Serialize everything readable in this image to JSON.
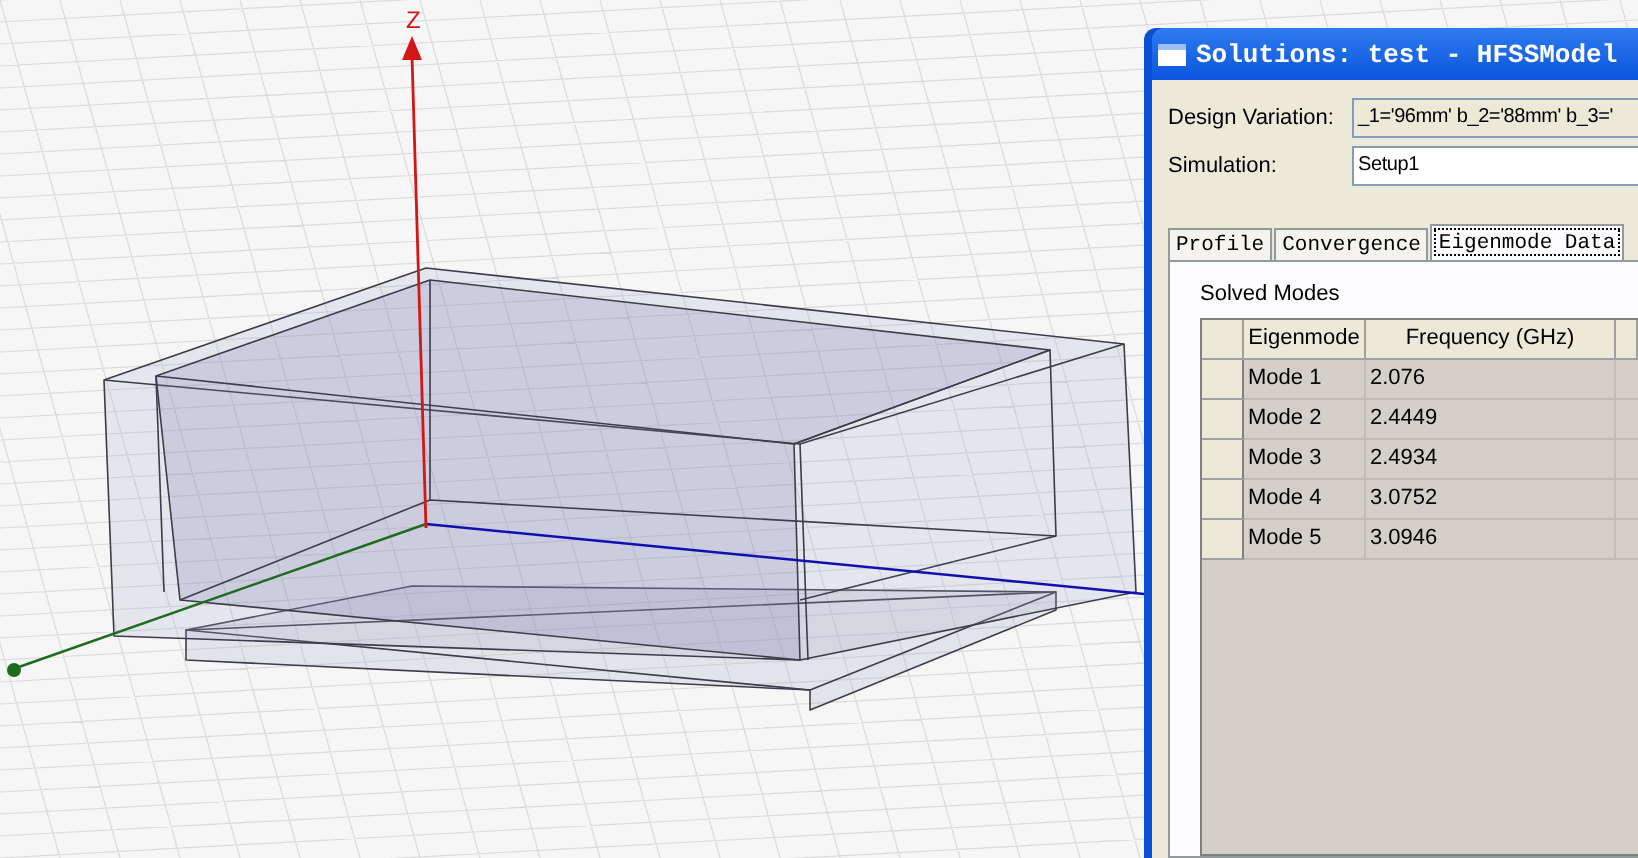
{
  "viewport": {
    "axis_label": "Z"
  },
  "window": {
    "title": "Solutions: test - HFSSModel",
    "fields": [
      {
        "label": "Design Variation:",
        "value": "_1='96mm' b_2='88mm' b_3='"
      },
      {
        "label": "Simulation:",
        "value": "Setup1"
      }
    ],
    "tabs": [
      {
        "label": "Profile",
        "selected": false
      },
      {
        "label": "Convergence",
        "selected": false
      },
      {
        "label": "Eigenmode Data",
        "selected": true
      }
    ],
    "group_label": "Solved Modes",
    "table": {
      "columns": [
        "Eigenmode",
        "Frequency (GHz)"
      ],
      "rows": [
        [
          "Mode 1",
          "2.076"
        ],
        [
          "Mode 2",
          "2.4449"
        ],
        [
          "Mode 3",
          "2.4934"
        ],
        [
          "Mode 4",
          "3.0752"
        ],
        [
          "Mode 5",
          "3.0946"
        ]
      ]
    }
  }
}
